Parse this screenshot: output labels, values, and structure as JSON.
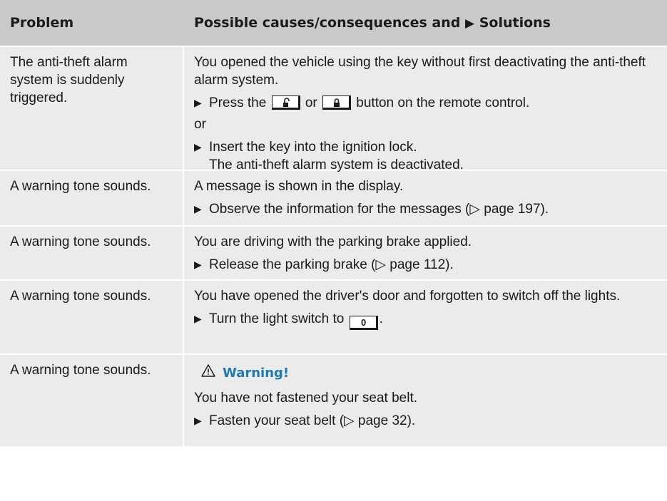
{
  "header": {
    "problem": "Problem",
    "causes_prefix": "Possible causes/consequences and",
    "causes_suffix": "Solutions"
  },
  "rows": [
    {
      "problem": "The anti-theft alarm system is suddenly triggered.",
      "cause": "You opened the vehicle using the key without first deactivating the anti-theft alarm system.",
      "step1_pre": "Press the",
      "step1_or": "or",
      "step1_post": "button on the remote control.",
      "or_text": "or",
      "step2_line1": "Insert the key into the ignition lock.",
      "step2_line2": "The anti-theft alarm system is deactivated."
    },
    {
      "problem": "A warning tone sounds.",
      "cause": "A message is shown in the display.",
      "step": "Observe the information for the messages (▷ page 197)."
    },
    {
      "problem": "A warning tone sounds.",
      "cause": "You are driving with the parking brake applied.",
      "step": "Release the parking brake (▷ page 112)."
    },
    {
      "problem": "A warning tone sounds.",
      "cause": "You have opened the driver's door and forgotten to switch off the lights.",
      "step_pre": "Turn the light switch to",
      "step_key": "0",
      "step_post": "."
    },
    {
      "problem": "A warning tone sounds.",
      "warning_title": "Warning!",
      "cause": "You have not fastened your seat belt.",
      "step": "Fasten your seat belt (▷ page 32)."
    }
  ],
  "icons": {
    "bullet": "triangle-right-icon",
    "unlock_key": "unlock-icon",
    "lock_key": "lock-icon",
    "warning": "warning-triangle-icon"
  },
  "colors": {
    "header_bg": "#c9c9c9",
    "row_bg": "#ebebeb",
    "warning_title": "#1f7bb0"
  }
}
